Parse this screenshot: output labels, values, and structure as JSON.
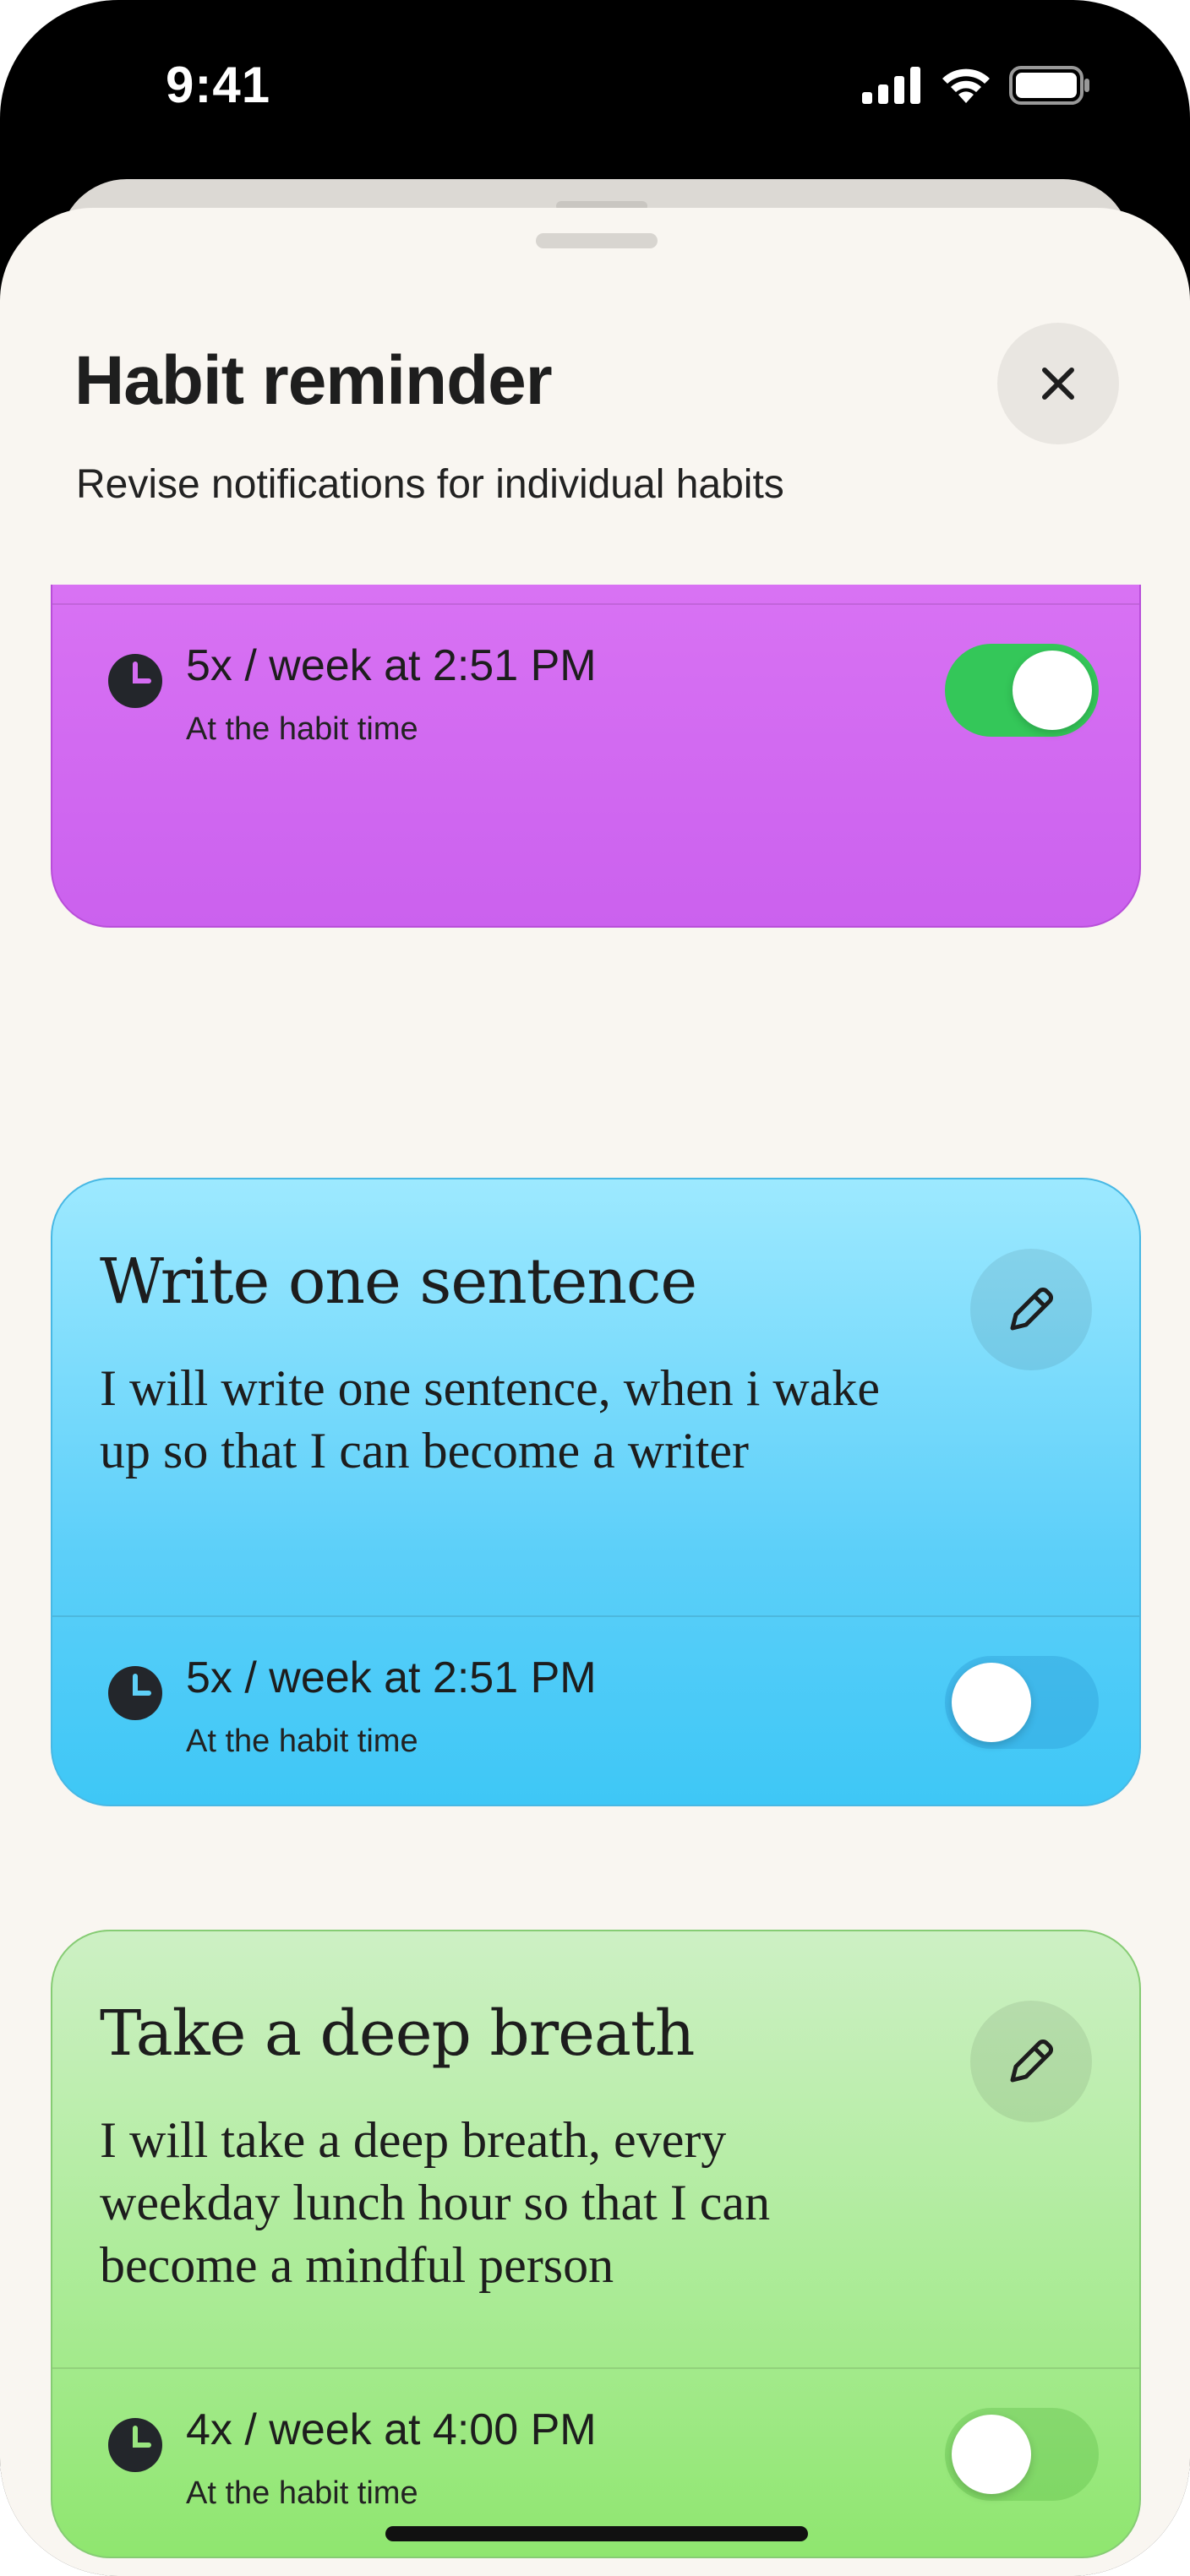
{
  "status_bar": {
    "time": "9:41"
  },
  "header": {
    "title": "Habit reminder",
    "subtitle": "Revise notifications for individual habits"
  },
  "habits": [
    {
      "title": "",
      "description": "",
      "frequency": "5x / week at 2:51 PM",
      "reminder_note": "At the habit time",
      "enabled": true,
      "color": "#d56cf3"
    },
    {
      "title": "Write one sentence",
      "description": "I will write one sentence, when i wake up so that I can become a writer",
      "frequency": "5x / week at 2:51 PM",
      "reminder_note": "At the habit time",
      "enabled": false,
      "color": "#6fd8fb"
    },
    {
      "title": "Take a deep breath",
      "description": "I will take a deep breath, every weekday lunch hour so that I can become a mindful person",
      "frequency": "4x / week at 4:00 PM",
      "reminder_note": "At the habit time",
      "enabled": false,
      "color": "#a8ea92"
    }
  ],
  "icons": {
    "close": "close-icon",
    "edit": "pencil-icon",
    "clock": "clock-icon"
  },
  "colors": {
    "sheet_background": "#f9f6f1",
    "toggle_on": "#34c759"
  }
}
